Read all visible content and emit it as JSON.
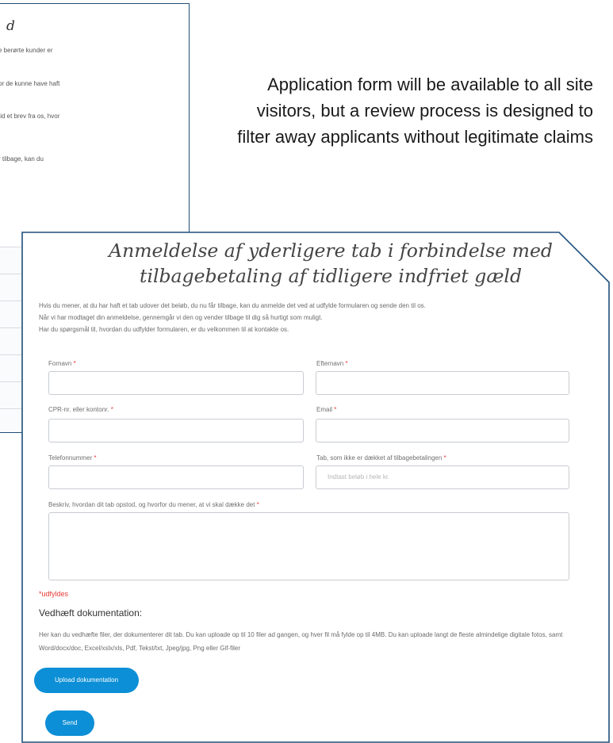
{
  "background_page": {
    "title": "d",
    "lines": [
      "e berørte kunder er",
      "or de kunne have haft",
      "tid et brev fra os, hvor",
      "r tilbage, kan du"
    ]
  },
  "annotation": {
    "text": "Application form will be available to all site visitors, but a review process is designed to filter away applicants without legitimate claims"
  },
  "form": {
    "title": "Anmeldelse af yderligere tab i forbindelse med tilbagebetaling af tidligere indfriet gæld",
    "intro": [
      "Hvis du mener, at du har haft et tab udover det beløb, du nu får tilbage, kan du anmelde det ved at udfylde formularen og sende den til os.",
      "Når vi har modtaget din anmeldelse, gennemgår vi den og vender tilbage til dig så hurtigt som muligt.",
      "Har du spørgsmål til, hvordan du udfylder formularen, er du velkommen til at kontakte os."
    ],
    "fields": {
      "first_name": {
        "label": "Fornavn",
        "required_mark": "*",
        "value": ""
      },
      "last_name": {
        "label": "Efternavn",
        "required_mark": "*",
        "value": ""
      },
      "cpr": {
        "label": "CPR-nr. eller kontonr.",
        "required_mark": "*",
        "value": ""
      },
      "email": {
        "label": "Email",
        "required_mark": "*",
        "value": ""
      },
      "phone": {
        "label": "Telefonnummer",
        "required_mark": "*",
        "value": ""
      },
      "loss_amount": {
        "label": "Tab, som ikke er dækket af tilbagebetalingen",
        "required_mark": "*",
        "placeholder": "Indtast beløb i hele kr."
      },
      "description": {
        "label": "Beskriv, hvordan dit tab opstod, og hvorfor du mener, at vi skal dække det",
        "required_mark": "*",
        "value": ""
      }
    },
    "required_note": "*udfyldes",
    "attach": {
      "title": "Vedhæft dokumentation:",
      "description": "Her kan du vedhæfte filer, der dokumenterer dit tab. Du kan uploade op til 10 filer ad gangen, og hver fil må fylde op til 4MB. Du kan uploade langt de fleste almindelige digitale fotos, samt Word/docx/doc, Excel/xslx/xls, Pdf, Tekst/txt, Jpeg/jpg, Png eller Gif-filer"
    },
    "buttons": {
      "upload": "Upload dokumentation",
      "send": "Send"
    }
  },
  "colors": {
    "frame": "#1f4e79",
    "button": "#0c8fd6",
    "required": "#e53935"
  }
}
